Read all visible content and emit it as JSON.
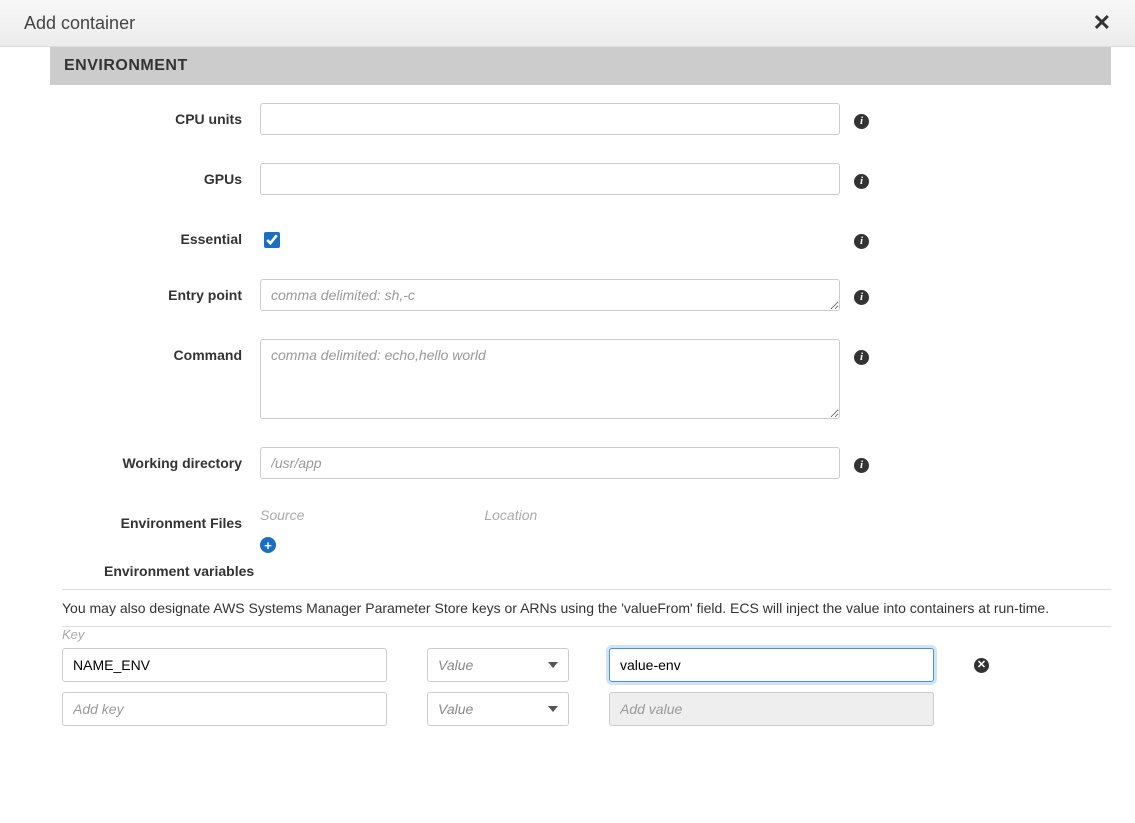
{
  "modal": {
    "title": "Add container"
  },
  "section": {
    "title": "ENVIRONMENT"
  },
  "fields": {
    "cpu_units": {
      "label": "CPU units",
      "value": ""
    },
    "gpus": {
      "label": "GPUs",
      "value": ""
    },
    "essential": {
      "label": "Essential",
      "checked": true
    },
    "entry_point": {
      "label": "Entry point",
      "value": "",
      "placeholder": "comma delimited: sh,-c"
    },
    "command": {
      "label": "Command",
      "value": "",
      "placeholder": "comma delimited: echo,hello world"
    },
    "working_dir": {
      "label": "Working directory",
      "value": "",
      "placeholder": "/usr/app"
    },
    "env_files": {
      "label": "Environment Files",
      "col_source": "Source",
      "col_location": "Location"
    }
  },
  "env_vars": {
    "heading": "Environment variables",
    "help": "You may also designate AWS Systems Manager Parameter Store keys or ARNs using the 'valueFrom' field. ECS will inject the value into containers at run-time.",
    "key_header": "Key",
    "select_placeholder": "Value",
    "rows": [
      {
        "key": "NAME_ENV",
        "type": "Value",
        "value": "value-env",
        "focused": true,
        "removable": true
      },
      {
        "key": "",
        "key_placeholder": "Add key",
        "type": "Value",
        "value": "",
        "value_placeholder": "Add value",
        "disabled": true,
        "removable": false
      }
    ]
  }
}
